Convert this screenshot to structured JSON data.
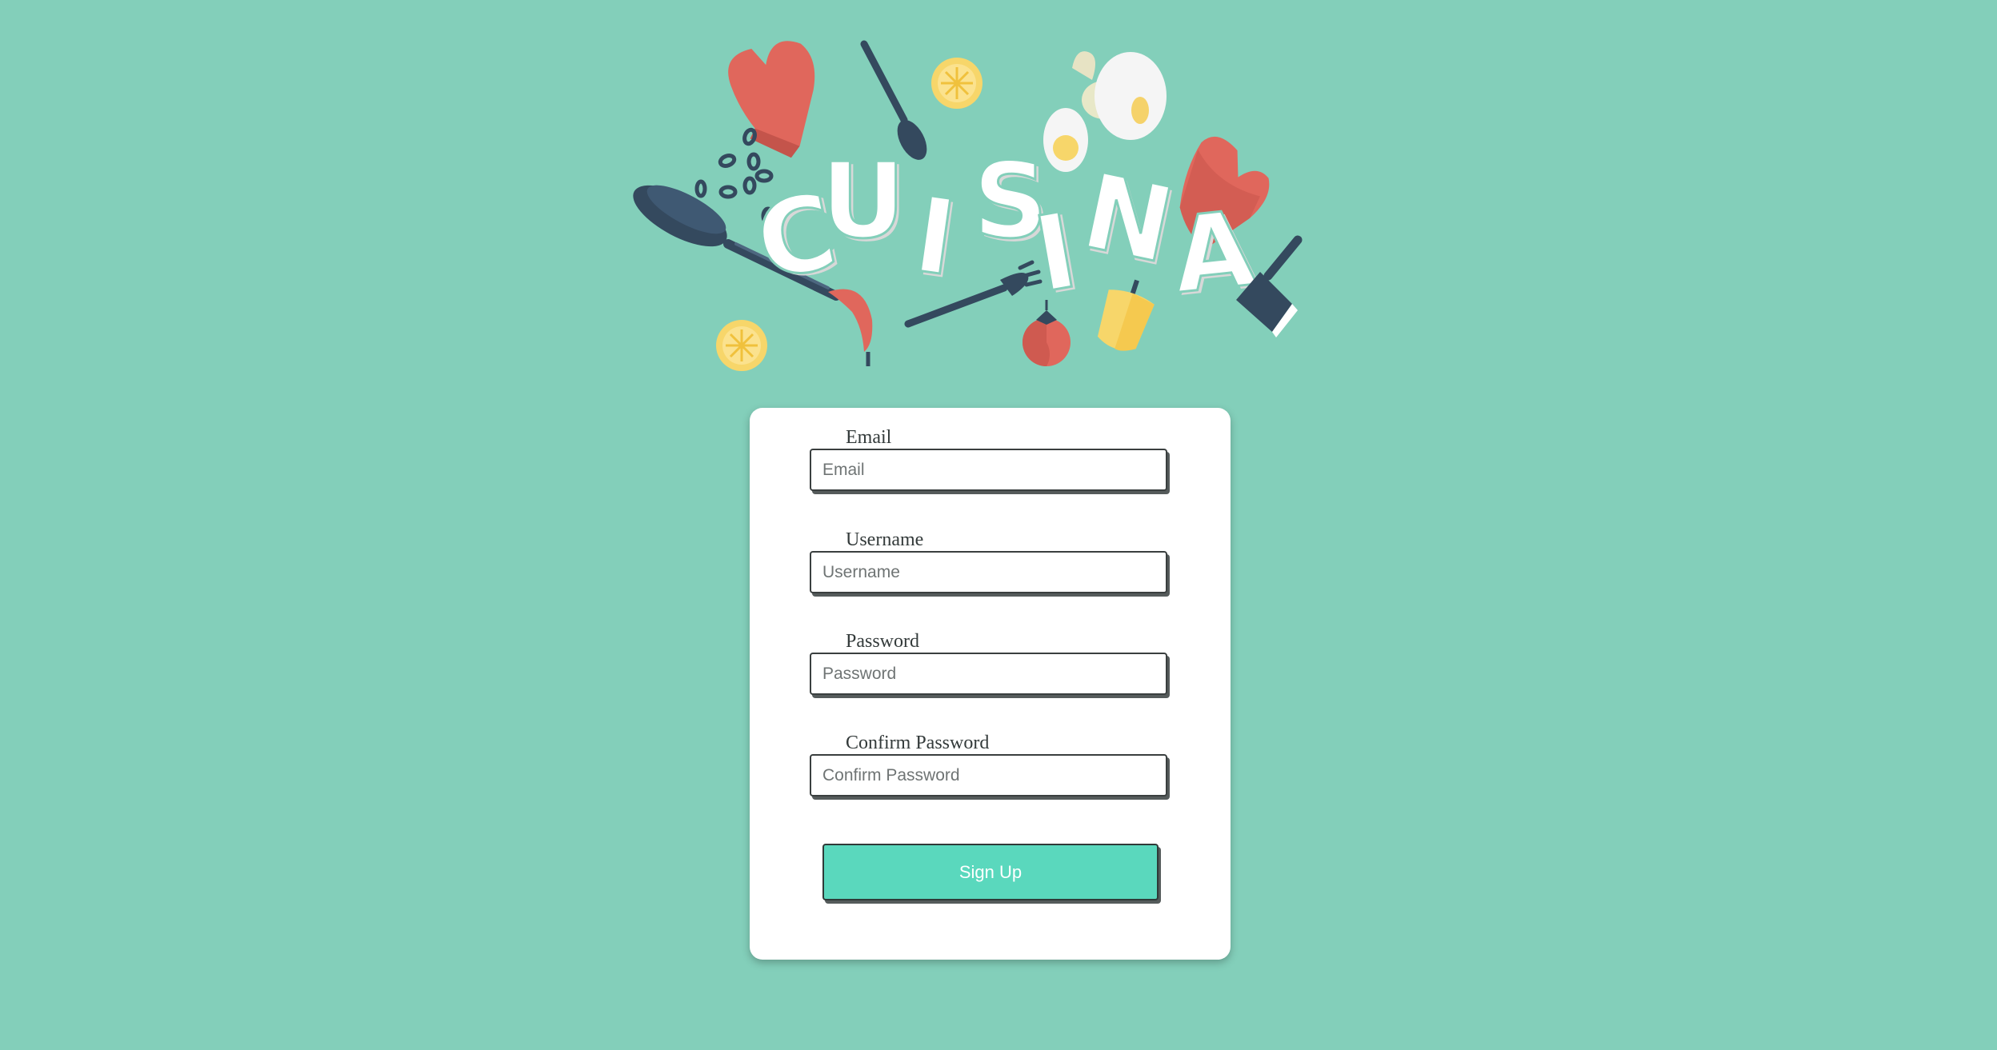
{
  "app": {
    "logo_text": "CUISINA"
  },
  "form": {
    "email": {
      "label": "Email",
      "placeholder": "Email",
      "value": ""
    },
    "username": {
      "label": "Username",
      "placeholder": "Username",
      "value": ""
    },
    "password": {
      "label": "Password",
      "placeholder": "Password",
      "value": ""
    },
    "confirm_password": {
      "label": "Confirm Password",
      "placeholder": "Confirm Password",
      "value": ""
    },
    "submit_label": "Sign Up"
  },
  "colors": {
    "background": "#83cfba",
    "card": "#ffffff",
    "button": "#5ad8bd",
    "accent_red": "#e0675c",
    "accent_yellow": "#f7d66a",
    "accent_navy": "#34495e"
  },
  "icons": [
    "oven-mitt-icon",
    "spoon-icon",
    "lemon-slice-icon",
    "cracked-egg-icon",
    "fried-egg-icon",
    "coffee-beans-icon",
    "frying-pan-icon",
    "chili-pepper-icon",
    "fork-icon",
    "tomato-icon",
    "bell-pepper-icon",
    "cleaver-knife-icon"
  ]
}
